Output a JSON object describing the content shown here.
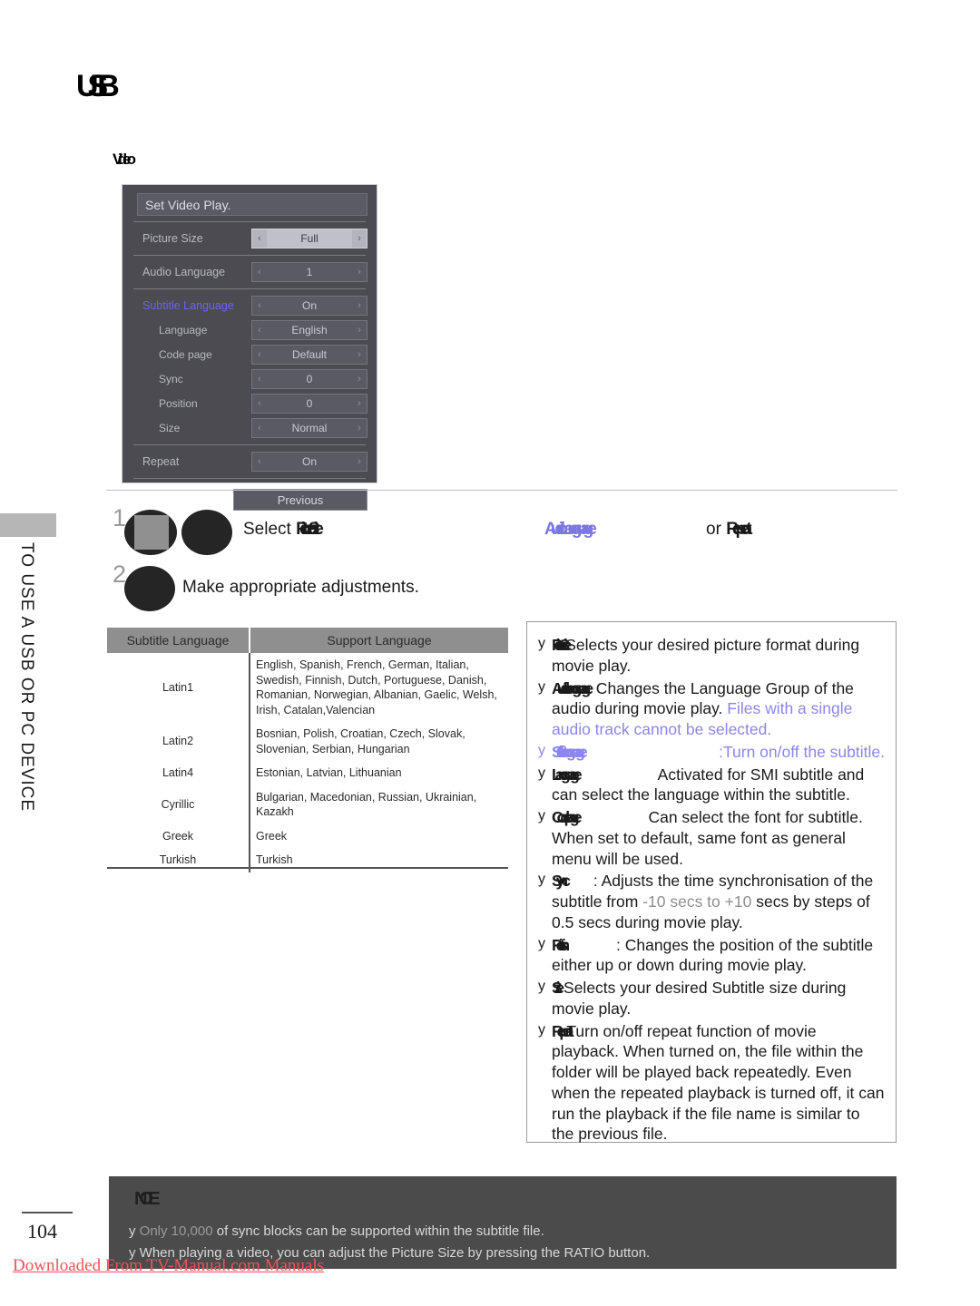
{
  "document": {
    "title": "USB",
    "subtitle": "Video",
    "page_number": "104",
    "sidebar_label": "TO USE A USB OR PC DEVICE",
    "watermark": "Downloaded From TV-Manual.com Manuals"
  },
  "osd": {
    "title": "Set Video Play.",
    "previous_label": "Previous",
    "left_arrow": "‹",
    "right_arrow": "›",
    "rows": [
      {
        "label": "Picture Size",
        "value": "Full",
        "indent": false,
        "highlight": true,
        "active": false
      },
      {
        "label": "Audio Language",
        "value": "1",
        "indent": false,
        "highlight": false,
        "active": false
      },
      {
        "label": "Subtitle Language",
        "value": "On",
        "indent": false,
        "highlight": false,
        "active": true
      },
      {
        "label": "Language",
        "value": "English",
        "indent": true,
        "highlight": false,
        "active": false
      },
      {
        "label": "Code page",
        "value": "Default",
        "indent": true,
        "highlight": false,
        "active": false
      },
      {
        "label": "Sync",
        "value": "0",
        "indent": true,
        "highlight": false,
        "active": false
      },
      {
        "label": "Position",
        "value": "0",
        "indent": true,
        "highlight": false,
        "active": false
      },
      {
        "label": "Size",
        "value": "Normal",
        "indent": true,
        "highlight": false,
        "active": false
      },
      {
        "label": "Repeat",
        "value": "On",
        "indent": false,
        "highlight": false,
        "active": false
      }
    ]
  },
  "steps": [
    {
      "number": "1",
      "text_before": "Select ",
      "label_glyph": "Picture Size",
      "middle_glyph": "Audio Language",
      "or_text": "or",
      "end_glyph": "Repeat"
    },
    {
      "number": "2",
      "text": "Make appropriate adjustments."
    }
  ],
  "language_table": {
    "headers": [
      "Subtitle Language",
      "Support Language"
    ],
    "rows": [
      {
        "code": "Latin1",
        "languages": "English, Spanish, French, German, Italian, Swedish, Finnish, Dutch, Portuguese, Danish, Romanian, Norwegian, Albanian, Gaelic, Welsh, Irish, Catalan,Valencian"
      },
      {
        "code": "Latin2",
        "languages": "Bosnian, Polish, Croatian, Czech, Slovak, Slovenian, Serbian, Hungarian"
      },
      {
        "code": "Latin4",
        "languages": "Estonian, Latvian, Lithuanian"
      },
      {
        "code": "Cyrillic",
        "languages": "Bulgarian, Macedonian, Russian, Ukrainian, Kazakh"
      },
      {
        "code": "Greek",
        "languages": "Greek"
      },
      {
        "code": "Turkish",
        "languages": "Turkish"
      }
    ]
  },
  "descriptions": {
    "bullet_char": "y",
    "items": [
      {
        "label": "Picture Size",
        "text": "Selects your desired picture format during movie play.",
        "blue_tail": "",
        "all_blue": false
      },
      {
        "label": "Audio Language",
        "text": ": Changes the Language Group of the audio during movie play. ",
        "blue_tail": "Files with a single audio track cannot be selected.",
        "all_blue": false
      },
      {
        "label": "Subtitle Language",
        "text": ":Turn on/off the subtitle.",
        "blue_tail": "",
        "all_blue": true
      },
      {
        "label": "Language",
        "text": "Activated for SMI subtitle and can select the language within the subtitle.",
        "blue_tail": "",
        "all_blue": false
      },
      {
        "label": "Code page",
        "text": "Can select the font for subtitle. When set to default, same font as general menu will be used.",
        "blue_tail": "",
        "all_blue": false
      },
      {
        "label": "Sync",
        "text": ": Adjusts the time synchronisation of the subtitle from ",
        "gray_mid": "-10 secs to +10",
        "text_after": " secs by steps of 0.5 secs during movie play.",
        "blue_tail": "",
        "all_blue": false
      },
      {
        "label": "Position",
        "text": ": Changes the position of the subtitle either up or down during movie play.",
        "blue_tail": "",
        "all_blue": false
      },
      {
        "label": "Size",
        "text": "Selects your desired Subtitle size during movie play.",
        "blue_tail": "",
        "all_blue": false
      },
      {
        "label": "Repeat",
        "text": "Turn on/off repeat function of movie playback. When turned on, the file within the folder will be played back repeatedly. Even when the repeated playback is turned off, it can run the playback if the file name is similar to the previous file.",
        "blue_tail": "",
        "all_blue": false
      }
    ]
  },
  "note": {
    "heading_glyph": "NOTE",
    "bullet_char": "y",
    "lines": [
      {
        "dim_lead": "Only 10,000",
        "rest": " of sync blocks can be supported within the subtitle file."
      },
      {
        "dim_lead": "",
        "rest": "When playing a video, you can adjust the Picture Size by pressing the RATIO button."
      }
    ]
  }
}
